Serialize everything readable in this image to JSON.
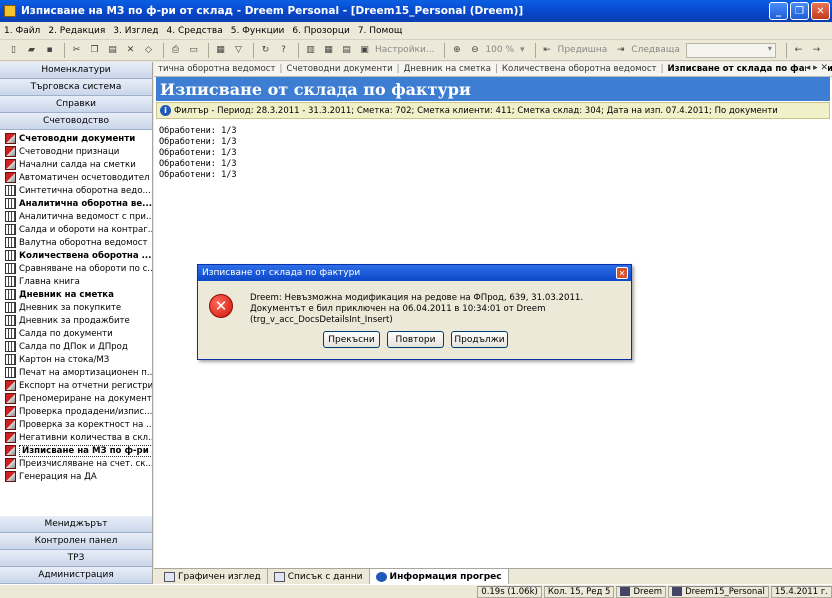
{
  "window": {
    "title": "Изписване на МЗ по ф-ри от склад - Dreem Personal - [Dreem15_Personal (Dreem)]",
    "minimize": "_",
    "restore": "❐",
    "close": "✕"
  },
  "menu": [
    "1. Файл",
    "2. Редакция",
    "3. Изглед",
    "4. Средства",
    "5. Функции",
    "6. Прозорци",
    "7. Помощ"
  ],
  "toolbar": {
    "settings_label": "Настройки...",
    "zoom_label": "100 %",
    "prev_label": "Предишна",
    "next_label": "Следваща"
  },
  "sidebar": {
    "top_buttons": [
      "Номенклатури",
      "Търговска система",
      "Справки",
      "Счетоводство"
    ],
    "items": [
      {
        "label": "Счетоводни документи",
        "bold": true,
        "icon": "red"
      },
      {
        "label": "Счетоводни признаци",
        "bold": false,
        "icon": "red"
      },
      {
        "label": "Начални салда на сметки",
        "bold": false,
        "icon": "red"
      },
      {
        "label": "Автоматичен осчетоводител",
        "bold": false,
        "icon": "red"
      },
      {
        "label": "Синтетична оборотна ведо...",
        "bold": false,
        "icon": "grid"
      },
      {
        "label": "Аналитична оборотна ве...",
        "bold": true,
        "icon": "grid"
      },
      {
        "label": "Аналитична ведомост с при...",
        "bold": false,
        "icon": "grid"
      },
      {
        "label": "Салда и обороти на контраг...",
        "bold": false,
        "icon": "grid"
      },
      {
        "label": "Валутна оборотна ведомост",
        "bold": false,
        "icon": "grid"
      },
      {
        "label": "Количествена оборотна ...",
        "bold": true,
        "icon": "grid"
      },
      {
        "label": "Сравняване на обороти по с...",
        "bold": false,
        "icon": "grid"
      },
      {
        "label": "Главна книга",
        "bold": false,
        "icon": "grid"
      },
      {
        "label": "Дневник на сметка",
        "bold": true,
        "icon": "grid"
      },
      {
        "label": "Дневник за покупките",
        "bold": false,
        "icon": "grid"
      },
      {
        "label": "Дневник за продажбите",
        "bold": false,
        "icon": "grid"
      },
      {
        "label": "Салда по документи",
        "bold": false,
        "icon": "grid"
      },
      {
        "label": "Салда по ДПок и ДПрод",
        "bold": false,
        "icon": "grid"
      },
      {
        "label": "Картон на стока/МЗ",
        "bold": false,
        "icon": "grid"
      },
      {
        "label": "Печат на амортизационен п...",
        "bold": false,
        "icon": "grid"
      },
      {
        "label": "Експорт на отчетни регистри",
        "bold": false,
        "icon": "red"
      },
      {
        "label": "Преномериране на документи",
        "bold": false,
        "icon": "red"
      },
      {
        "label": "Проверка продадени/изпис...",
        "bold": false,
        "icon": "red"
      },
      {
        "label": "Проверка за коректност на ...",
        "bold": false,
        "icon": "red"
      },
      {
        "label": "Негативни количества в скл...",
        "bold": false,
        "icon": "red"
      },
      {
        "label": "Изписване на МЗ по ф-ри ...",
        "bold": true,
        "icon": "red",
        "selected": true
      },
      {
        "label": "Преизчисляване на счет. ск...",
        "bold": false,
        "icon": "red"
      },
      {
        "label": "Генерация на ДА",
        "bold": false,
        "icon": "red"
      }
    ],
    "bottom_buttons": [
      "Мениджърът",
      "Контролен панел",
      "ТРЗ",
      "Администрация"
    ]
  },
  "tabs": {
    "items": [
      "тична оборотна ведомост",
      "Счетоводни документи",
      "Дневник на сметка",
      "Количествена оборотна ведомост",
      "Изписване от склада по фактури"
    ],
    "controls": "◂ ▸ ✕"
  },
  "header": {
    "title": "Изписване от склада по фактури"
  },
  "filter": {
    "text": "Филтър - Период: 28.3.2011 - 31.3.2011; Сметка: 702; Сметка клиенти: 411; Сметка склад: 304; Дата на изп. 07.4.2011; По документи"
  },
  "log": [
    "Обработени: 1/3",
    "Обработени: 1/3",
    "Обработени: 1/3",
    "Обработени: 1/3",
    "Обработени: 1/3"
  ],
  "bottom_tabs": [
    "Графичен изглед",
    "Списък с данни",
    "Информация прогрес"
  ],
  "status": {
    "time": "0.19s (1.06k)",
    "position": "Кол. 15, Ред 5",
    "user": "Dreem",
    "database": "Dreem15_Personal",
    "date": "15.4.2011 г."
  },
  "dialog": {
    "title": "Изписване от склада по фактури",
    "close": "✕",
    "message": "Dreem: Невъзможна модификация на редове на ФПрод, 639, 31.03.2011. Документът е бил приключен на 06.04.2011 в 10:34:01 от Dreem (trg_v_acc_DocsDetailsInt_Insert)",
    "buttons": [
      "Прекъсни",
      "Повтори",
      "Продължи"
    ]
  },
  "colors": {
    "header_bg": "#3e7ed2",
    "title_bar": "#0845c8",
    "filter_bg": "#f2f0c8",
    "error_red": "#d0120a"
  }
}
